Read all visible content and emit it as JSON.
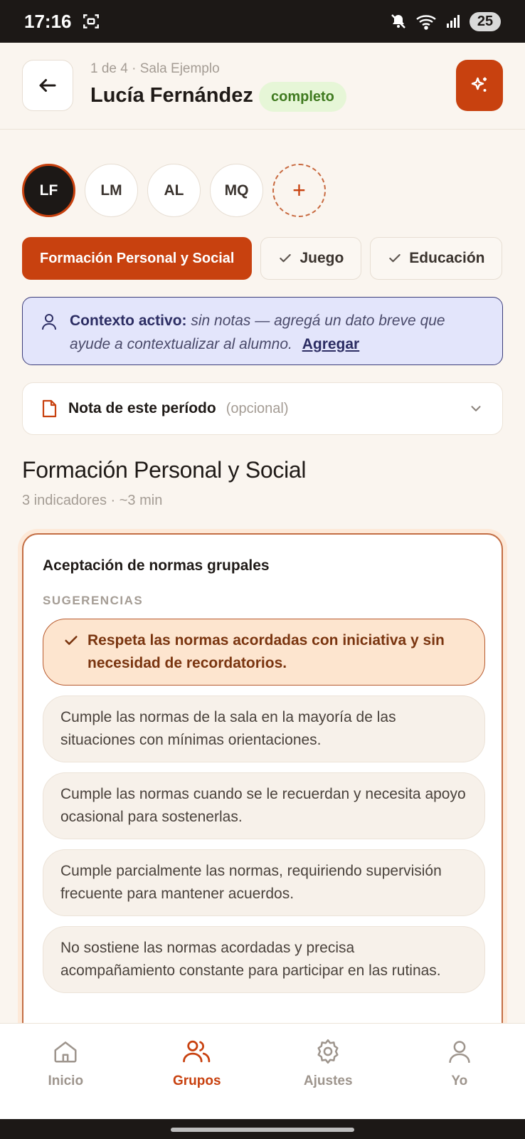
{
  "status_bar": {
    "time": "17:16",
    "battery": "25",
    "icons": [
      "screenshot-icon",
      "mute-icon",
      "wifi-icon",
      "signal-icon"
    ]
  },
  "header": {
    "breadcrumb": "1 de 4 · Sala Ejemplo",
    "student_name": "Lucía Fernández",
    "status": "completo",
    "accent_color": "#c8410f",
    "status_color": "#e6f6d7"
  },
  "avatars": [
    {
      "initials": "LF",
      "active": true
    },
    {
      "initials": "LM",
      "active": false
    },
    {
      "initials": "AL",
      "active": false
    },
    {
      "initials": "MQ",
      "active": false
    }
  ],
  "add_avatar_label": "+",
  "tabs": [
    {
      "label": "Formación Personal y Social",
      "active": true,
      "done": false
    },
    {
      "label": "Juego",
      "active": false,
      "done": true
    },
    {
      "label": "Educación",
      "active": false,
      "done": true
    }
  ],
  "context": {
    "label": "Contexto activo:",
    "message": "sin notas — agregá un dato breve que ayude a contextualizar al alumno.",
    "link": "Agregar"
  },
  "note": {
    "title": "Nota de este período",
    "optional": "(opcional)"
  },
  "section": {
    "title": "Formación Personal y Social",
    "meta": "3 indicadores · ~3 min"
  },
  "indicator": {
    "title": "Aceptación de normas grupales",
    "suggestions_label": "SUGERENCIAS",
    "options": [
      {
        "text": "Respeta las normas acordadas con iniciativa y sin necesidad de recordatorios.",
        "selected": true
      },
      {
        "text": "Cumple las normas de la sala en la mayoría de las situaciones con mínimas orientaciones.",
        "selected": false
      },
      {
        "text": "Cumple las normas cuando se le recuerdan y necesita apoyo ocasional para sostenerlas.",
        "selected": false
      },
      {
        "text": "Cumple parcialmente las normas, requiriendo supervisión frecuente para mantener acuerdos.",
        "selected": false
      },
      {
        "text": "No sostiene las normas acordadas y precisa acompañamiento constante para participar en las rutinas.",
        "selected": false
      }
    ]
  },
  "bottom_nav": [
    {
      "label": "Inicio",
      "icon": "home-icon",
      "active": false
    },
    {
      "label": "Grupos",
      "icon": "users-icon",
      "active": true
    },
    {
      "label": "Ajustes",
      "icon": "gear-icon",
      "active": false
    },
    {
      "label": "Yo",
      "icon": "user-icon",
      "active": false
    }
  ]
}
